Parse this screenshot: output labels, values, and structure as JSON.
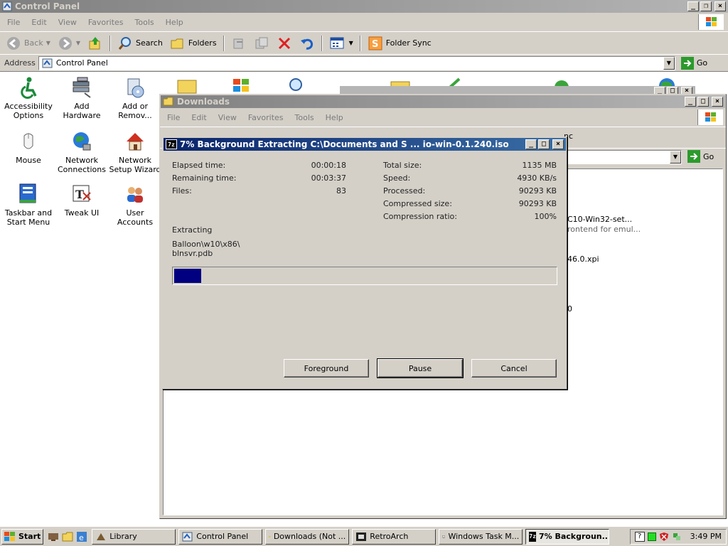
{
  "control_panel": {
    "title": "Control Panel",
    "menu": [
      "File",
      "Edit",
      "View",
      "Favorites",
      "Tools",
      "Help"
    ],
    "toolbar": {
      "back": "Back",
      "search": "Search",
      "folders": "Folders",
      "folder_sync": "Folder Sync"
    },
    "address_label": "Address",
    "address_value": "Control Panel",
    "go_label": "Go",
    "items": [
      {
        "label": "Accessibility Options"
      },
      {
        "label": "Add Hardware"
      },
      {
        "label": "Add or Remov..."
      },
      {
        "label": "Mouse"
      },
      {
        "label": "Network Connections"
      },
      {
        "label": "Network Setup Wizard"
      },
      {
        "label": "Taskbar and Start Menu"
      },
      {
        "label": "Tweak UI"
      },
      {
        "label": "User Accounts"
      }
    ]
  },
  "downloads": {
    "title": "Downloads",
    "menu": [
      "File",
      "Edit",
      "View",
      "Favorites",
      "Tools",
      "Help"
    ],
    "go_label": "Go",
    "toolbar_partial": "nc",
    "files": [
      {
        "name": "C10-Win32-set..."
      },
      {
        "name": "rontend for emul..."
      },
      {
        "name": "46.0.xpi"
      },
      {
        "name": "0"
      }
    ]
  },
  "dialog": {
    "title": "7% Background Extracting C:\\Documents and S ... io-win-0.1.240.iso",
    "progress_percent": 7,
    "elapsed_label": "Elapsed time:",
    "elapsed_value": "00:00:18",
    "remaining_label": "Remaining time:",
    "remaining_value": "00:03:37",
    "files_label": "Files:",
    "files_value": "83",
    "total_size_label": "Total size:",
    "total_size_value": "1135 MB",
    "speed_label": "Speed:",
    "speed_value": "4930 KB/s",
    "processed_label": "Processed:",
    "processed_value": "90293 KB",
    "compressed_label": "Compressed size:",
    "compressed_value": "90293 KB",
    "ratio_label": "Compression ratio:",
    "ratio_value": "100%",
    "status": "Extracting",
    "current_path": "Balloon\\w10\\x86\\",
    "current_file": "blnsvr.pdb",
    "buttons": {
      "foreground": "Foreground",
      "pause": "Pause",
      "cancel": "Cancel"
    }
  },
  "taskbar": {
    "start": "Start",
    "tasks": [
      {
        "label": "Library"
      },
      {
        "label": "Control Panel"
      },
      {
        "label": "Downloads (Not ..."
      },
      {
        "label": "RetroArch"
      },
      {
        "label": "Windows Task M..."
      },
      {
        "label": "7% Backgroun..."
      }
    ],
    "clock": "3:49 PM"
  },
  "colors": {
    "title_active": "#0a246a",
    "progress_fill": "#000080",
    "face": "#d4d0c8"
  }
}
